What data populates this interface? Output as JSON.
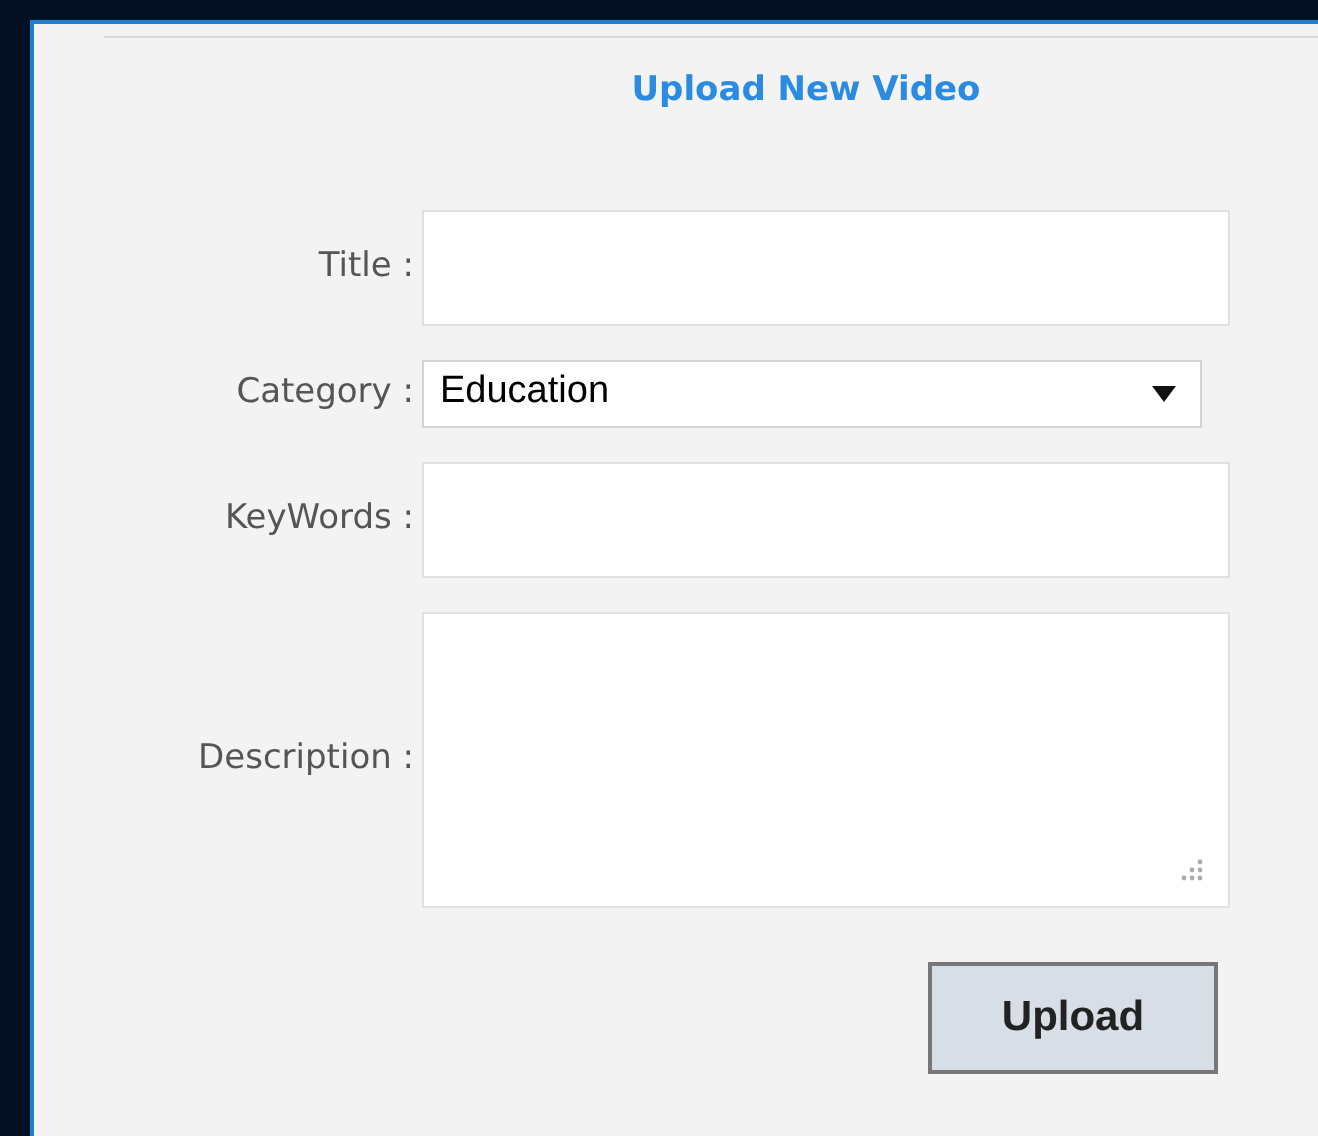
{
  "heading": "Upload New Video",
  "fields": [
    {
      "kind": "text",
      "label": "Title :"
    },
    {
      "kind": "select",
      "label": "Category :",
      "value": "Education"
    },
    {
      "kind": "text",
      "label": "KeyWords :"
    },
    {
      "kind": "textarea",
      "label": "Description :"
    }
  ],
  "submit": "Upload"
}
